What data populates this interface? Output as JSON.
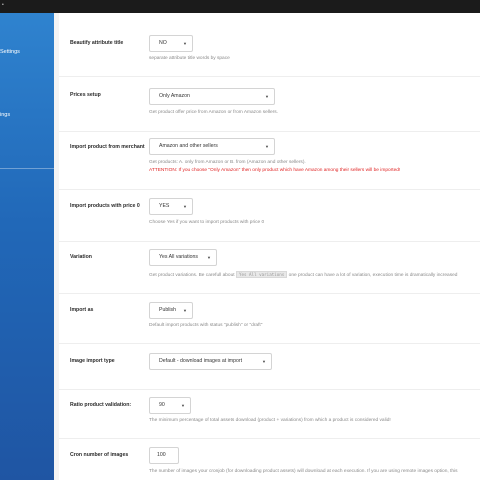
{
  "sidebar": {
    "items": [
      {
        "label": "Settings"
      },
      {
        "label": "ings"
      }
    ]
  },
  "rows": [
    {
      "label": "Beautify attribute title",
      "value": "NO",
      "help": "separate attribute title words by space"
    },
    {
      "label": "Prices setup",
      "value": "Only Amazon",
      "help": "Get product offer price from Amazon or from Amazon sellers."
    },
    {
      "label": "Import product from merchant",
      "value": "Amazon and other sellers",
      "help": "Get products: A. only from Amazon or B. from (Amazon and other sellers).",
      "warning": "ATTENTION: If you choose \"Only Amazon\" then only product which have Amazon among their sellers will be imported!"
    },
    {
      "label": "Import products with price 0",
      "value": "YES",
      "help": "Choose Yes if you want to import products with price 0"
    },
    {
      "label": "Variation",
      "value": "Yes All variations",
      "help_before": "Get product variations. Be carefull about",
      "help_code": "Yes All variations",
      "help_after": "one product can have a lot of variation, execution time is dramatically increased"
    },
    {
      "label": "Import as",
      "value": "Publish",
      "help": "Default import products with status \"publish\" or \"draft\""
    },
    {
      "label": "Image import type",
      "value": "Default - download images at import",
      "help": ""
    },
    {
      "label": "Ratio product validation:",
      "value": "90",
      "help": "The minimum percentage of total assets download (product + variations) from which a product is considered valid!"
    },
    {
      "label": "Cron number of images",
      "value": "100",
      "help": "The number of images your cronjob (for downloading product assets) will download at each execution. If you are using remote images option, this"
    }
  ]
}
